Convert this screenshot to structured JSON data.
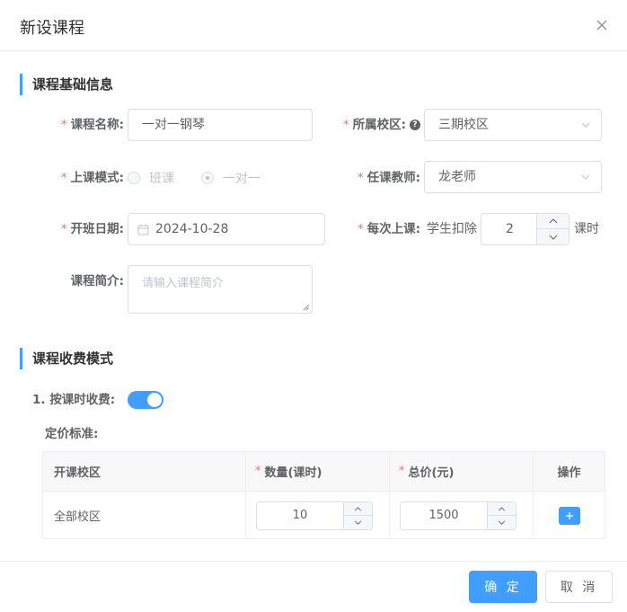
{
  "dialog": {
    "title": "新设课程"
  },
  "sections": {
    "basic": "课程基础信息",
    "fee": "课程收费模式"
  },
  "form": {
    "course_name": {
      "label": "课程名称:",
      "value": "一对一钢琴"
    },
    "campus": {
      "label": "所属校区:",
      "value": "三期校区",
      "help": "?"
    },
    "mode": {
      "label": "上课模式:",
      "options": [
        "班课",
        "一对一"
      ],
      "selected": "一对一"
    },
    "teacher": {
      "label": "任课教师:",
      "value": "龙老师"
    },
    "start_date": {
      "label": "开班日期:",
      "value": "2024-10-28"
    },
    "per_class": {
      "label": "每次上课:",
      "prefix": "学生扣除",
      "value": "2",
      "suffix": "课时"
    },
    "intro": {
      "label": "课程简介:",
      "placeholder": "请输入课程简介"
    }
  },
  "fee": {
    "by_hour_label": "1. 按课时收费:",
    "by_hour_enabled": true,
    "pricing_label": "定价标准:",
    "table": {
      "headers": [
        "开课校区",
        "数量(课时)",
        "总价(元)",
        "操作"
      ],
      "rows": [
        {
          "campus": "全部校区",
          "quantity": "10",
          "total": "1500"
        }
      ]
    }
  },
  "buttons": {
    "confirm": "确 定",
    "cancel": "取 消"
  },
  "required_mark": "*",
  "colors": {
    "accent": "#409eff",
    "required": "#f56c6c"
  }
}
